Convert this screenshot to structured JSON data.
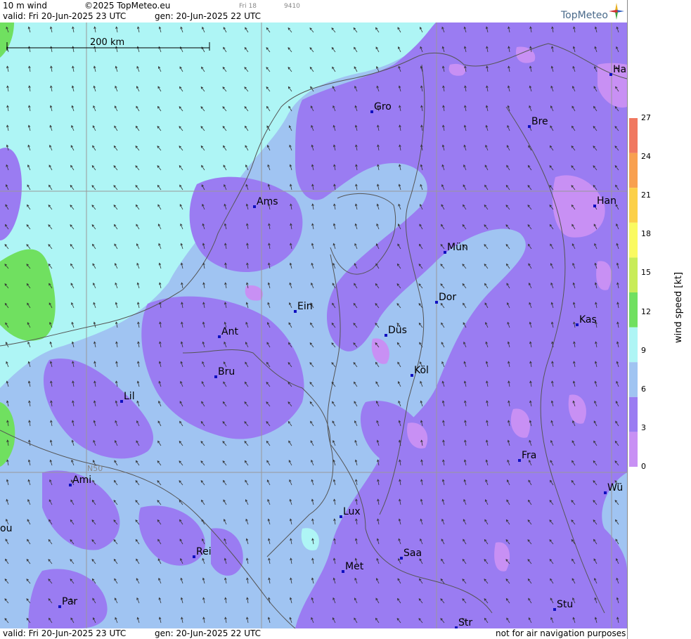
{
  "header": {
    "field": "10 m wind",
    "copyright": "©2025 TopMeteo.eu",
    "valid": "valid:  Fri  20-Jun-2025  23 UTC",
    "gen": "gen: 20-Jun-2025 22 UTC",
    "small_day": "Fri 18",
    "small_code": "9410"
  },
  "logo": {
    "text": "TopMeteo"
  },
  "footer": {
    "valid": "valid:  Fri  20-Jun-2025  23 UTC",
    "gen": "gen: 20-Jun-2025 22 UTC",
    "disclaimer": "not for air navigation purposes"
  },
  "scale_bar": {
    "label": "200 km"
  },
  "latitude_label": "N50",
  "cities": [
    {
      "name": "Gro"
    },
    {
      "name": "Bre"
    },
    {
      "name": "Ha"
    },
    {
      "name": "Ams"
    },
    {
      "name": "Han"
    },
    {
      "name": "Mün"
    },
    {
      "name": "Ein"
    },
    {
      "name": "Dor"
    },
    {
      "name": "Ant"
    },
    {
      "name": "Düs"
    },
    {
      "name": "Kas"
    },
    {
      "name": "Bru"
    },
    {
      "name": "Köl"
    },
    {
      "name": "Lil"
    },
    {
      "name": "Fra"
    },
    {
      "name": "Ami"
    },
    {
      "name": "Wü"
    },
    {
      "name": "Lux"
    },
    {
      "name": "Rei"
    },
    {
      "name": "Saa"
    },
    {
      "name": "Met"
    },
    {
      "name": "Par"
    },
    {
      "name": "Stu"
    },
    {
      "name": "Str"
    },
    {
      "name": "ou"
    }
  ],
  "colorbar": {
    "title": "wind  speed  [kt]",
    "ticks": [
      "27",
      "24",
      "21",
      "18",
      "15",
      "12",
      "9",
      "6",
      "3",
      "0"
    ],
    "colors": [
      "#f07860",
      "#f8a050",
      "#fcd048",
      "#fafa60",
      "#c8ec58",
      "#70e060",
      "#aef5f5",
      "#a0c4f2",
      "#9a7cf2",
      "#c890f4"
    ]
  },
  "colors": {
    "calm": "#c890f4",
    "light": "#9a7cf2",
    "moderate": "#a0c4f2",
    "fresh": "#aef5f5",
    "strong": "#70e060"
  }
}
